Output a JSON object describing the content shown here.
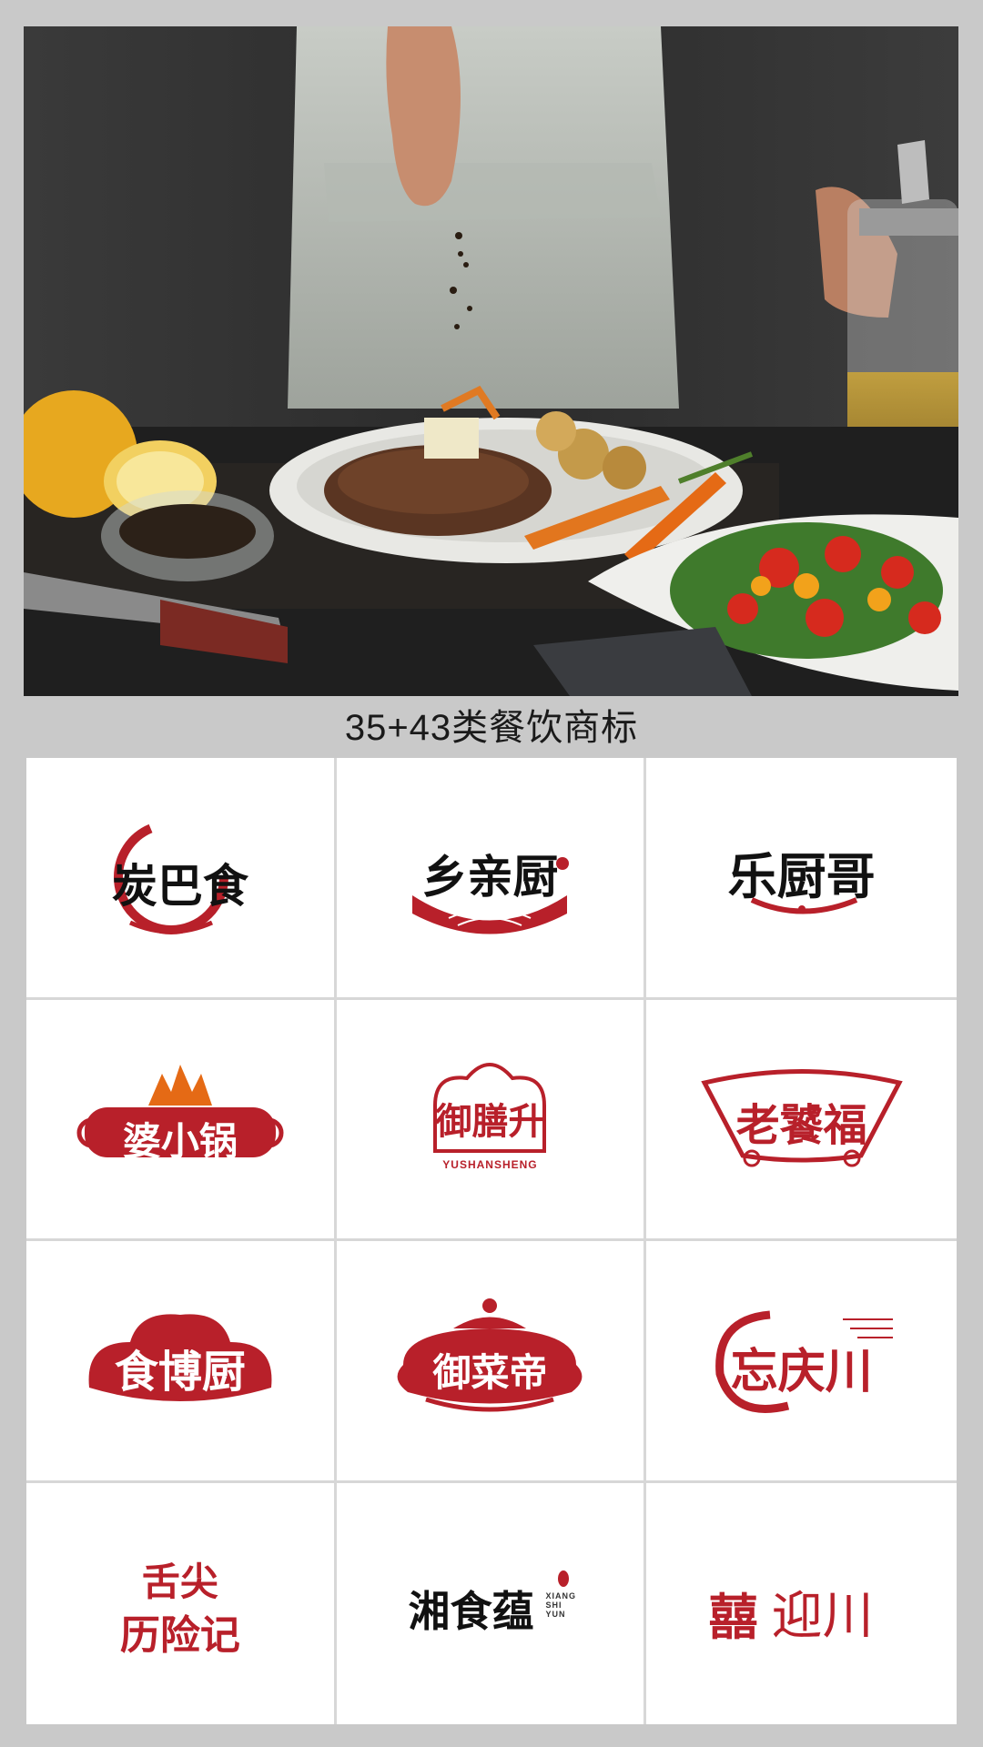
{
  "caption": "35+43类餐饮商标",
  "colors": {
    "brand_red": "#b8202a",
    "ink": "#111111",
    "frame": "#c9c9c9"
  },
  "logos": [
    {
      "name": "炭巴食"
    },
    {
      "name": "乡亲厨"
    },
    {
      "name": "乐厨哥"
    },
    {
      "name": "婆小锅"
    },
    {
      "name": "御膳升",
      "pinyin": "YUSHANSHENG"
    },
    {
      "name": "老饕福"
    },
    {
      "name": "食博厨"
    },
    {
      "name": "御菜帝"
    },
    {
      "name": "忘庆川"
    },
    {
      "line1": "舌尖",
      "line2": "历险记"
    },
    {
      "name": "湘食蕴",
      "pinyin1": "XIANG",
      "pinyin2": "SHI",
      "pinyin3": "YUN"
    },
    {
      "symbol": "囍",
      "name": "迎川"
    }
  ]
}
